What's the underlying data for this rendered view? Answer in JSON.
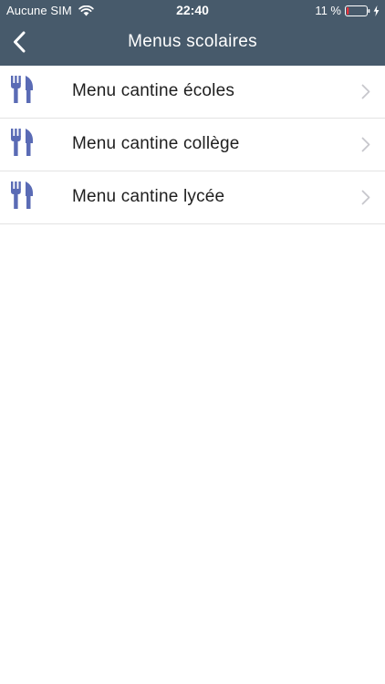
{
  "status_bar": {
    "carrier": "Aucune SIM",
    "time": "22:40",
    "battery_percent": "11 %",
    "battery_level": 0.11,
    "wifi_icon": "wifi-icon",
    "battery_icon": "battery-icon",
    "charging_icon": "charging-icon"
  },
  "nav_bar": {
    "title": "Menus scolaires",
    "back_icon": "chevron-left-icon",
    "background_color": "#475a6b"
  },
  "menu_items": [
    {
      "label": "Menu cantine écoles",
      "icon": "cutlery-icon"
    },
    {
      "label": "Menu cantine collège",
      "icon": "cutlery-icon"
    },
    {
      "label": "Menu cantine lycée",
      "icon": "cutlery-icon"
    }
  ],
  "colors": {
    "icon_accent": "#5a6bb5",
    "chevron": "#c7c7cc",
    "battery_low": "#e8303a"
  }
}
